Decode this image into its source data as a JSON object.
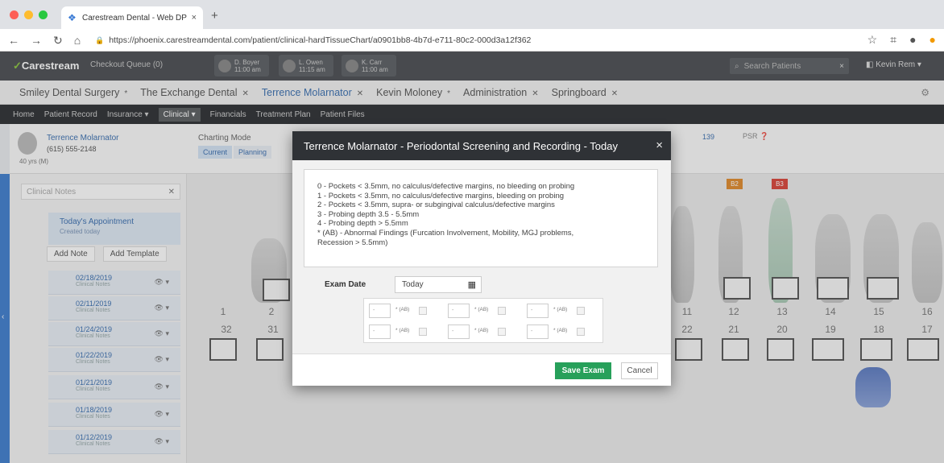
{
  "browser": {
    "tab_title": "Carestream Dental - Web DPM",
    "tab_close": "×",
    "new_tab": "+",
    "url": "https://phoenix.carestreamdental.com/patient/clinical-hardTissueChart/a0901bb8-4b7d-e711-80c2-000d3a12f362"
  },
  "app": {
    "logo": "Carestream",
    "checkout_queue": "Checkout Queue (0)",
    "chips": [
      {
        "name": "D. Boyer",
        "time": "11:00 am"
      },
      {
        "name": "L. Owen",
        "time": "11:15 am"
      },
      {
        "name": "K. Carr",
        "time": "11:00 am"
      }
    ],
    "search_placeholder": "Search Patients",
    "user": "Kevin Rem"
  },
  "practice_tabs": [
    {
      "label": "Smiley Dental Surgery"
    },
    {
      "label": "The Exchange Dental"
    },
    {
      "label": "Terrence Molarnator"
    },
    {
      "label": "Kevin Moloney"
    },
    {
      "label": "Administration"
    },
    {
      "label": "Springboard"
    }
  ],
  "module_nav": [
    "Home",
    "Patient Record",
    "Insurance ▾",
    "Clinical ▾",
    "Financials",
    "Treatment Plan",
    "Patient Files"
  ],
  "patient": {
    "name": "Terrence Molarnator",
    "phone": "(615) 555-2148",
    "age": "40 yrs  (M)",
    "charting_mode": "Charting Mode",
    "mode_current": "Current",
    "mode_planning": "Planning",
    "psr_value": "139",
    "psr_label": "PSR"
  },
  "left_panel": {
    "search_placeholder": "Clinical Notes",
    "scheduled": "Today's Appointment",
    "scheduled_sub": "Created today",
    "add_note": "Add Note",
    "add_template": "Add Template",
    "history": [
      {
        "date": "02/18/2019",
        "note": "Clinical Notes"
      },
      {
        "date": "02/11/2019",
        "note": "Clinical Notes"
      },
      {
        "date": "01/24/2019",
        "note": "Clinical Notes"
      },
      {
        "date": "01/22/2019",
        "note": "Clinical Notes"
      },
      {
        "date": "01/21/2019",
        "note": "Clinical Notes"
      },
      {
        "date": "01/18/2019",
        "note": "Clinical Notes"
      },
      {
        "date": "01/12/2019",
        "note": "Clinical Notes"
      }
    ]
  },
  "chart": {
    "upper_numbers": [
      "1",
      "2",
      "11",
      "12",
      "13",
      "14",
      "15",
      "16"
    ],
    "lower_numbers": [
      "32",
      "31",
      "22",
      "21",
      "20",
      "19",
      "18",
      "17"
    ],
    "badges": [
      "B2",
      "B3"
    ]
  },
  "modal": {
    "title": "Terrence Molarnator - Periodontal Screening and Recording - Today",
    "close": "×",
    "legend": [
      "0 - Pockets < 3.5mm, no calculus/defective margins, no bleeding on probing",
      "1 - Pockets < 3.5mm, no calculus/defective margins, bleeding on probing",
      "2 - Pockets < 3.5mm, supra- or subgingival calculus/defective margins",
      "3 - Probing depth 3.5 - 5.5mm",
      "4 - Probing depth > 5.5mm",
      "* (AB) - Abnormal Findings (Furcation Involvement, Mobility, MGJ problems,",
      "Recession > 5.5mm)"
    ],
    "exam_date_label": "Exam Date",
    "exam_date_value": "Today",
    "sextant_placeholder": "-",
    "ab_label": "* (AB)",
    "save_label": "Save Exam",
    "cancel_label": "Cancel"
  }
}
